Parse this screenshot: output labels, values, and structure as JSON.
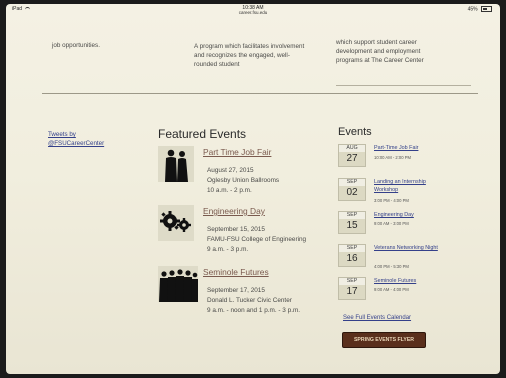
{
  "statusbar": {
    "left": "iPad",
    "time": "10:38 AM",
    "url": "career.fsu.edu",
    "battery": "45%"
  },
  "top_columns": {
    "col1": "job opportunities.",
    "col2": "A program which facilitates involvement and recognizes the engaged, well-rounded student",
    "col3": "which support student career development and employment programs at The Career Center"
  },
  "sidebar": {
    "tweets_link": "Tweets by @FSUCareerCenter"
  },
  "featured": {
    "title": "Featured Events",
    "events": [
      {
        "icon": "silhouette-pair-icon",
        "link": "Part Time Job Fair",
        "date": "August 27, 2015",
        "location": "Oglesby Union Ballrooms",
        "time": "10 a.m. - 2 p.m."
      },
      {
        "icon": "gears-icon",
        "link": "Engineering Day",
        "date": "September 15, 2015",
        "location": "FAMU-FSU College of Engineering",
        "time": "9 a.m. - 3 p.m."
      },
      {
        "icon": "silhouette-group-icon",
        "link": "Seminole Futures",
        "date": "September 17, 2015",
        "location": "Donald L. Tucker Civic Center",
        "time": "9 a.m. - noon and 1 p.m. - 3 p.m."
      }
    ]
  },
  "events_sidebar": {
    "title": "Events",
    "items": [
      {
        "month": "AUG",
        "day": "27",
        "name": "Part-Time Job Fair",
        "time": "10:00 AM - 2:00 PM"
      },
      {
        "month": "SEP",
        "day": "02",
        "name": "Landing an Internship Workshop",
        "time": "3:00 PM - 4:00 PM"
      },
      {
        "month": "SEP",
        "day": "15",
        "name": "Engineering Day",
        "time": "9:00 AM - 3:00 PM"
      },
      {
        "month": "SEP",
        "day": "16",
        "name": "Veterans Networking Night",
        "time": "4:00 PM - 5:30 PM"
      },
      {
        "month": "SEP",
        "day": "17",
        "name": "Seminole Futures",
        "time": "9:00 AM - 4:00 PM"
      }
    ],
    "full_calendar_link": "See Full Events Calendar",
    "flyer_button": "SPRING EVENTS FLYER"
  },
  "colors": {
    "page_background": "#f1eede",
    "link_blue": "#34408a",
    "event_link": "#7a5a4e",
    "flyer_button": "#5a2f1c"
  }
}
